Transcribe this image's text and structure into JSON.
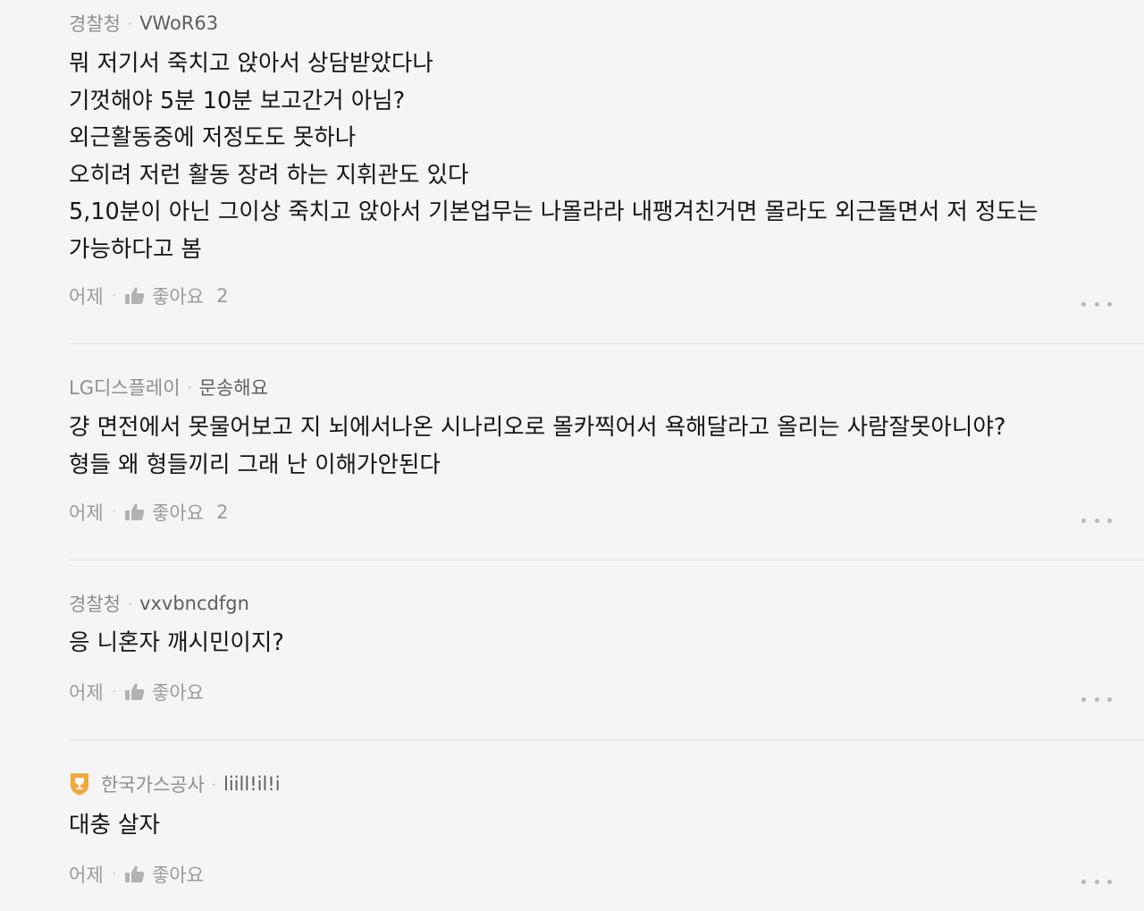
{
  "comments": [
    {
      "company": "경찰청",
      "nickname": "VWoR63",
      "lines": [
        "뭐 저기서 죽치고 앉아서 상담받았다나",
        "기껏해야 5분 10분 보고간거 아님?",
        "외근활동중에 저정도도 못하나",
        "오히려 저런 활동 장려 하는 지휘관도 있다",
        "5,10분이 아닌 그이상 죽치고 앉아서 기본업무는 나몰라라 내팽겨친거면 몰라도 외근돌면서 저 정도는",
        "가능하다고 봄"
      ],
      "time": "어제",
      "like_label": "좋아요",
      "like_count": "2"
    },
    {
      "company": "LG디스플레이",
      "nickname": "문송해요",
      "lines": [
        "걍 면전에서 못물어보고 지 뇌에서나온 시나리오로 몰카찍어서 욕해달라고 올리는 사람잘못아니야?",
        "형들 왜 형들끼리 그래 난 이해가안된다"
      ],
      "time": "어제",
      "like_label": "좋아요",
      "like_count": "2"
    },
    {
      "company": "경찰청",
      "nickname": "vxvbncdfgn",
      "lines": [
        "응 니혼자 깨시민이지?"
      ],
      "time": "어제",
      "like_label": "좋아요",
      "like_count": ""
    },
    {
      "company": "한국가스공사",
      "nickname": "liill!il!i",
      "lines": [
        "대충 살자"
      ],
      "time": "어제",
      "like_label": "좋아요",
      "like_count": "",
      "badge_icon": "trophy-badge-icon"
    }
  ],
  "meta_separator": "·",
  "icons": {
    "like": "thumbs-up-icon",
    "more": "more-dots-icon"
  },
  "colors": {
    "background": "#f5f5f7",
    "text": "#161616",
    "muted": "#8e8e93",
    "badge_gold": "#f2a93b"
  }
}
